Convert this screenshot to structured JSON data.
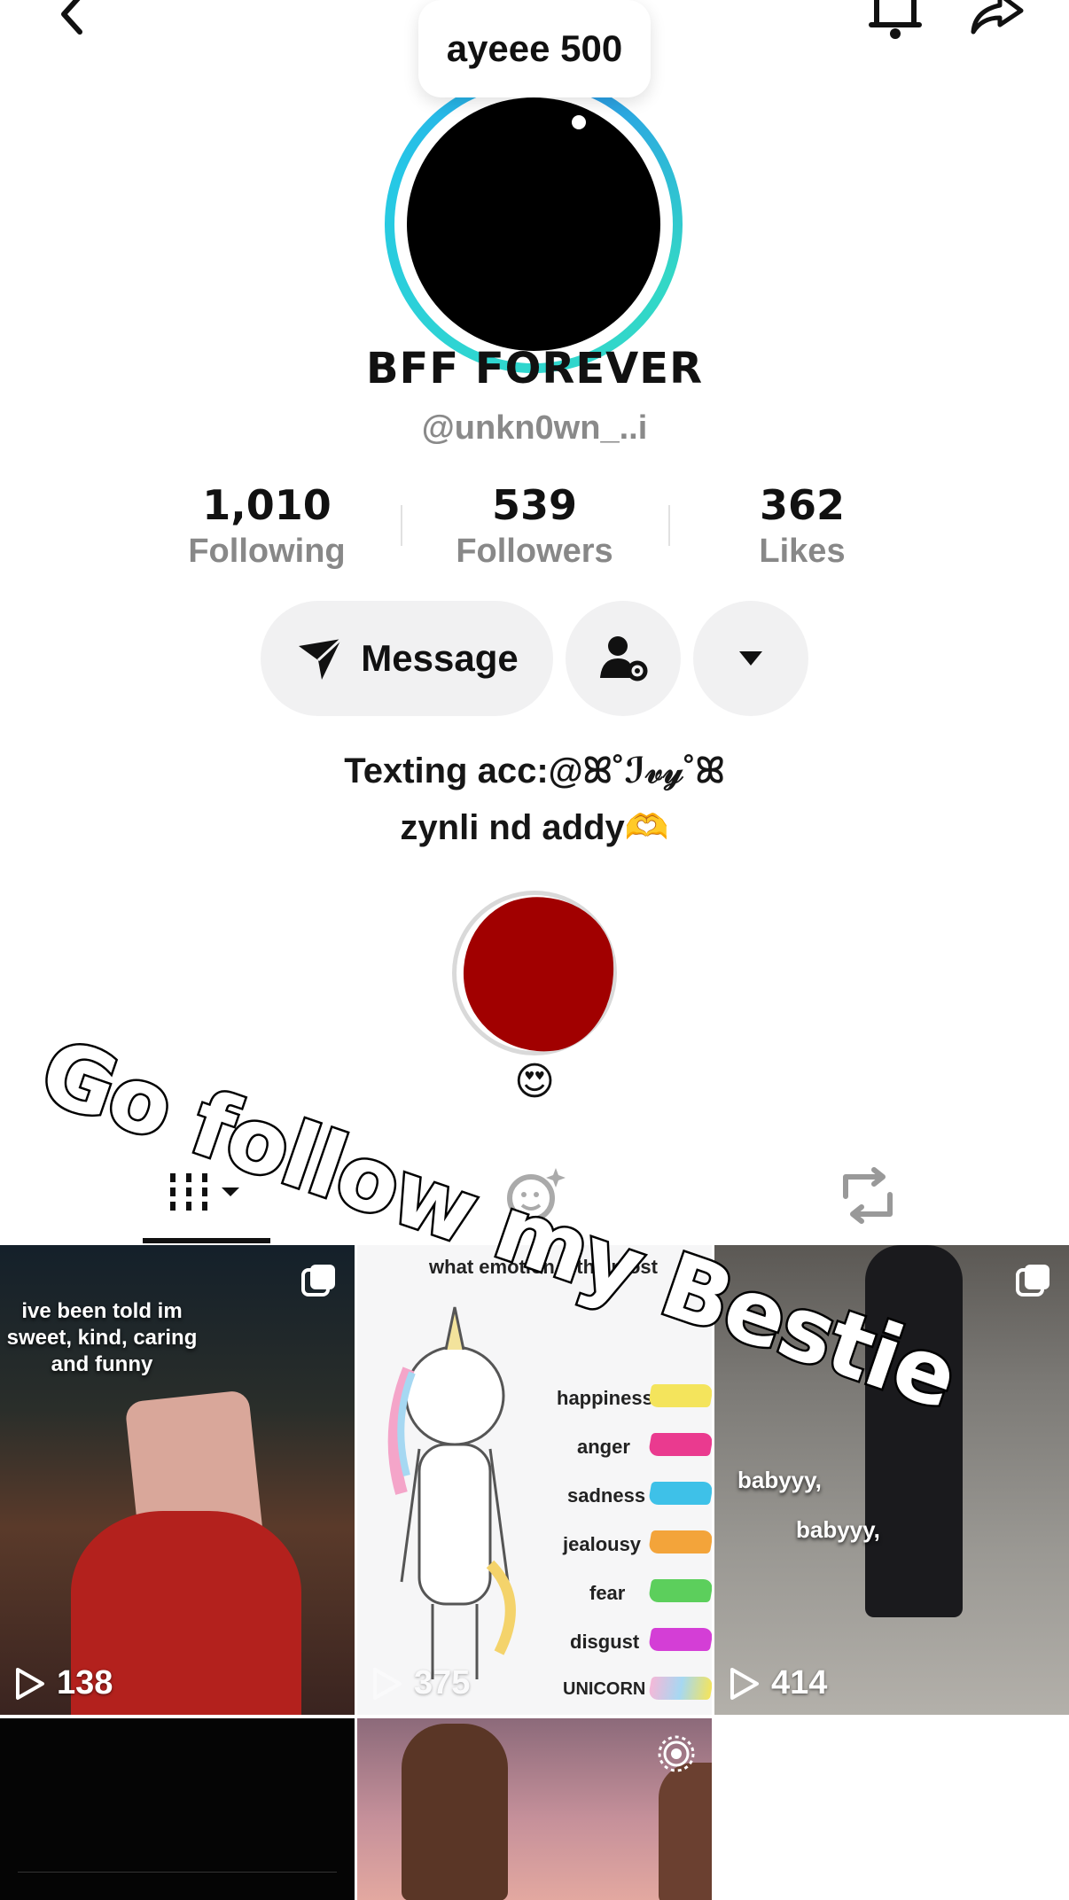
{
  "header": {
    "back_icon": "chevron-left-icon",
    "bell_icon": "bell-icon",
    "share_icon": "share-arrow-icon"
  },
  "note": {
    "text": "ayeee 500"
  },
  "profile": {
    "display_name": "BFF FOREVER",
    "username": "@unkn0wn_..i",
    "ring_colors": [
      "#2fd6d0",
      "#2a9be8"
    ]
  },
  "stats": [
    {
      "value": "1,010",
      "label": "Following"
    },
    {
      "value": "539",
      "label": "Followers"
    },
    {
      "value": "362",
      "label": "Likes"
    }
  ],
  "actions": {
    "message_label": "Message",
    "message_icon": "send-icon",
    "friend_settings_icon": "user-gear-icon",
    "more_icon": "caret-down-icon"
  },
  "bio": {
    "line1": "Texting acc:@ꕤ˚ℐ𝓋𝓎˚ꕤ",
    "line2": "zynli nd addy🫶"
  },
  "featured_friend": {
    "emoji": "😍",
    "blob_color": "#a10000"
  },
  "tabs": [
    {
      "name": "videos",
      "icon": "grid-icon",
      "active": true
    },
    {
      "name": "reposts-ai",
      "icon": "sparkle-face-icon",
      "active": false
    },
    {
      "name": "reposts",
      "icon": "repost-icon",
      "active": false
    }
  ],
  "overlay": {
    "text": "Go follow my Bestie"
  },
  "grid": {
    "tiles": [
      {
        "caption": "ive been told im sweet, kind, caring and funny",
        "views": "138",
        "corner_icon": "multi-photo-icon"
      },
      {
        "title": "what emotion... the most",
        "emotions": [
          {
            "label": "happiness",
            "color": "#f4e45c"
          },
          {
            "label": "anger",
            "color": "#ea3a8f"
          },
          {
            "label": "sadness",
            "color": "#3ec1e8"
          },
          {
            "label": "jealousy",
            "color": "#f3a43a"
          },
          {
            "label": "fear",
            "color": "#5ccf5c"
          },
          {
            "label": "disgust",
            "color": "#d43ed6"
          },
          {
            "label": "UNICORN",
            "color": "#f4b8d8"
          }
        ],
        "views": "375"
      },
      {
        "caption_a": "babyyy,",
        "caption_b": "babyyy,",
        "views": "414",
        "corner_icon": "multi-photo-icon"
      },
      {
        "type": "dark-screen"
      },
      {
        "corner_icon": "live-icon"
      }
    ]
  }
}
